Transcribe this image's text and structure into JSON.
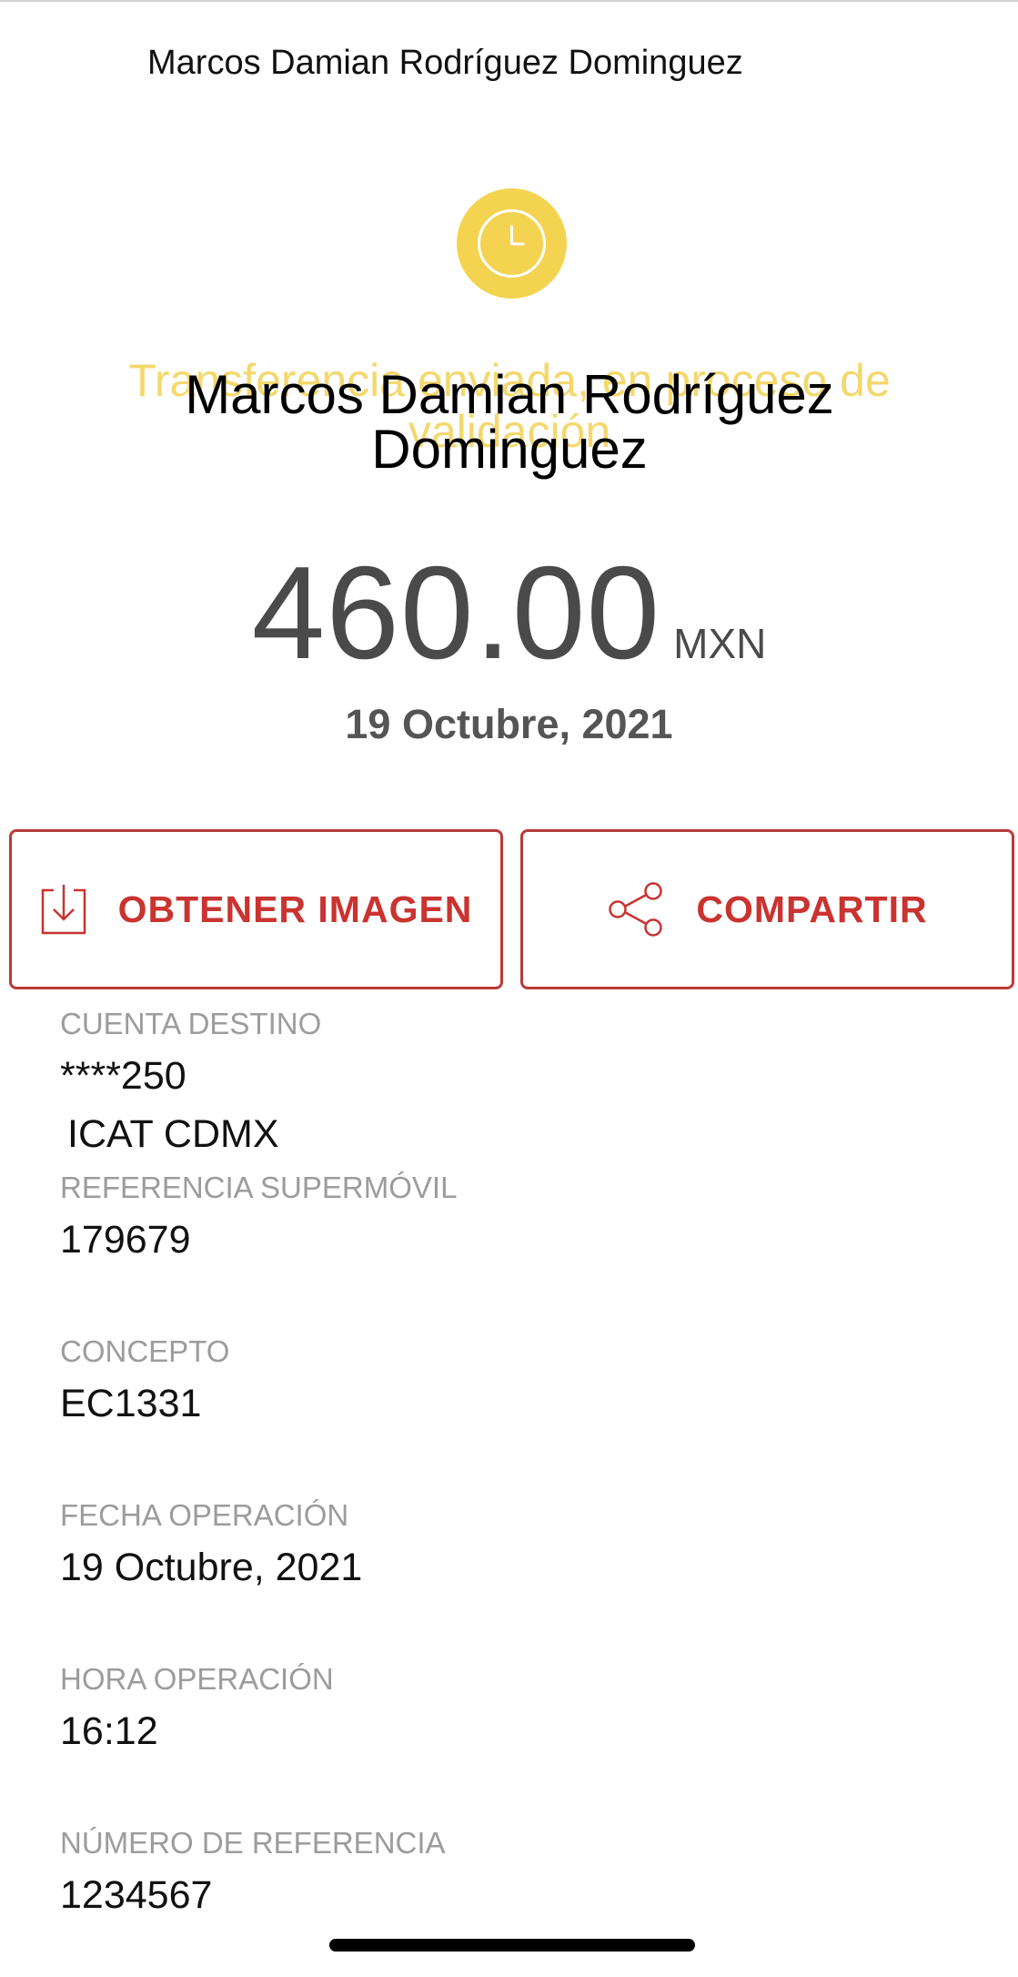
{
  "header": {
    "name": "Marcos Damian Rodríguez Dominguez"
  },
  "status": {
    "icon": "clock-icon",
    "text": "Transferencia enviada, en proceso de validación",
    "color": "#f4d351"
  },
  "beneficiary": {
    "name": "Marcos Damian Rodríguez Dominguez"
  },
  "amount": {
    "value": "460.00",
    "currency": "MXN"
  },
  "date": "19 Octubre, 2021",
  "actions": {
    "download_label": "OBTENER IMAGEN",
    "download_icon": "download-icon",
    "share_label": "COMPARTIR",
    "share_icon": "share-icon",
    "accent_color": "#c93330"
  },
  "details": {
    "cuenta_destino": {
      "label": "CUENTA DESTINO",
      "value": "****250",
      "subvalue": "ICAT CDMX"
    },
    "referencia_supermovil": {
      "label": "REFERENCIA SUPERMÓVIL",
      "value": "179679"
    },
    "concepto": {
      "label": "CONCEPTO",
      "value": "EC1331"
    },
    "fecha_operacion": {
      "label": "FECHA OPERACIÓN",
      "value": "19 Octubre, 2021"
    },
    "hora_operacion": {
      "label": "HORA OPERACIÓN",
      "value": "16:12"
    },
    "numero_referencia": {
      "label": "NÚMERO DE REFERENCIA",
      "value": "1234567"
    }
  }
}
